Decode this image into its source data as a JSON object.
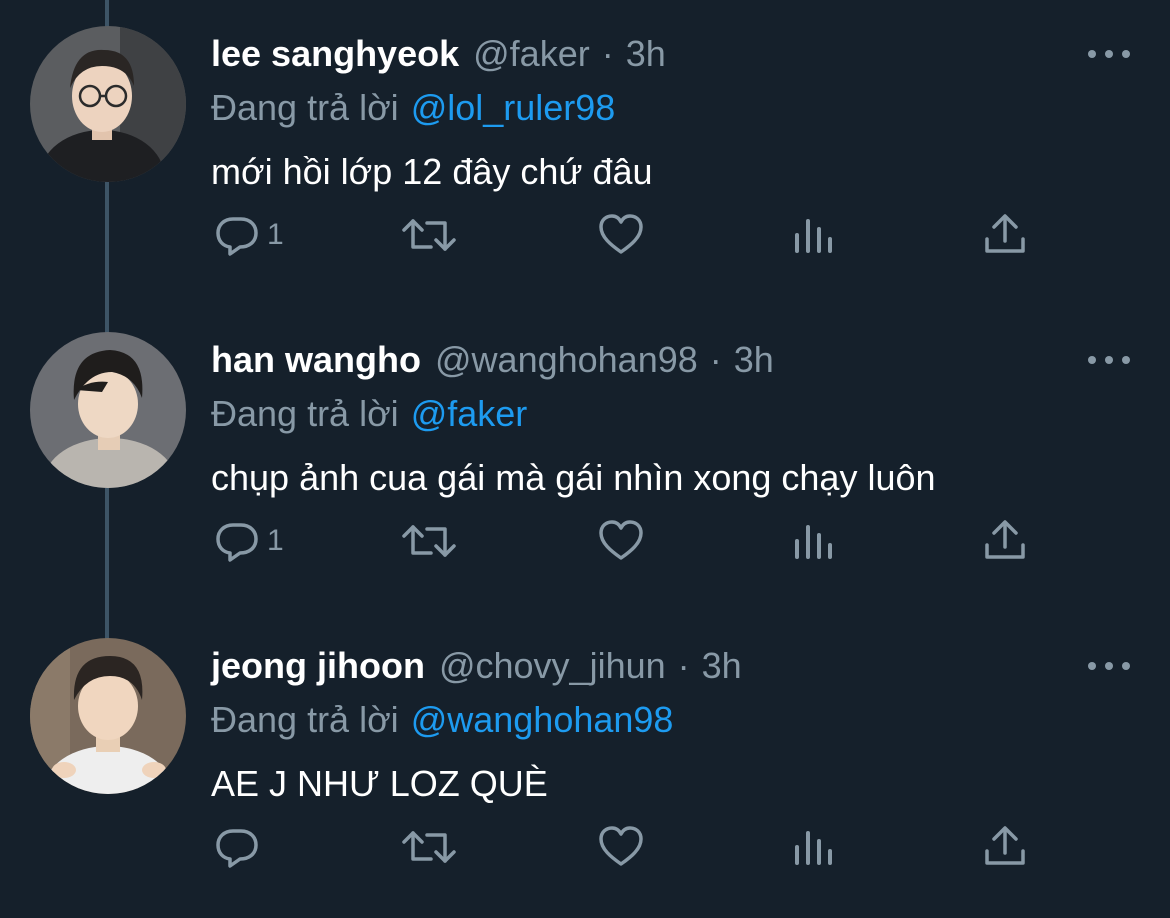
{
  "colors": {
    "background": "#15202b",
    "secondary_text": "#8899a6",
    "link": "#1d9bf0",
    "thread_line": "#3d5466"
  },
  "tweets": [
    {
      "name": "lee sanghyeok",
      "handle": "@faker",
      "dot": "·",
      "time": "3h",
      "reply_prefix": "Đang trả lời",
      "reply_to": "@lol_ruler98",
      "text": "mới hồi lớp 12 đây chứ đâu",
      "reply_count": "1",
      "avatar_icon": "user-avatar"
    },
    {
      "name": "han wangho",
      "handle": "@wanghohan98",
      "dot": "·",
      "time": "3h",
      "reply_prefix": "Đang trả lời",
      "reply_to": "@faker",
      "text": "chụp ảnh cua gái mà gái nhìn xong chạy luôn",
      "reply_count": "1",
      "avatar_icon": "user-avatar"
    },
    {
      "name": "jeong jihoon",
      "handle": "@chovy_jihun",
      "dot": "·",
      "time": "3h",
      "reply_prefix": "Đang trả lời",
      "reply_to": "@wanghohan98",
      "text": "AE J NHƯ LOZ QUÈ",
      "reply_count": "",
      "avatar_icon": "user-avatar"
    }
  ],
  "action_icons": [
    "reply-icon",
    "retweet-icon",
    "like-icon",
    "analytics-icon",
    "share-icon"
  ]
}
